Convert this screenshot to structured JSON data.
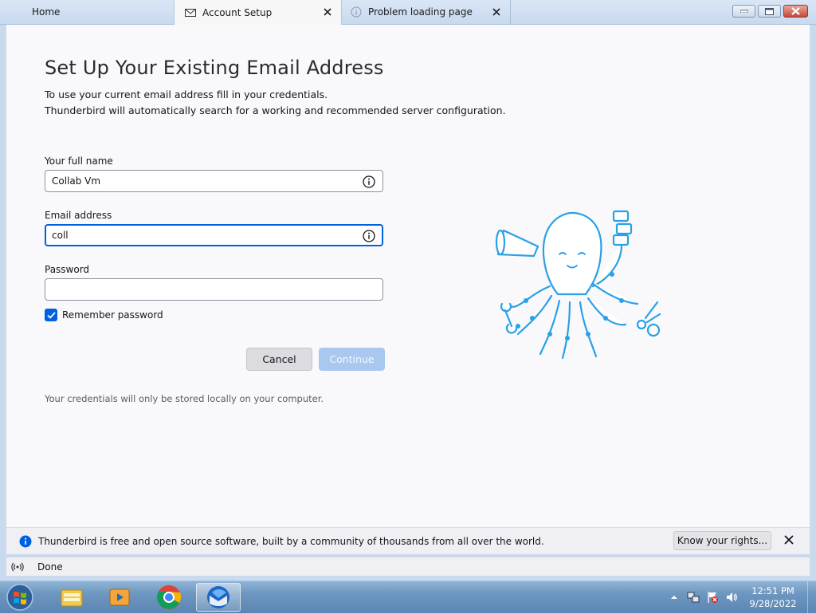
{
  "tabs": [
    {
      "label": "Home"
    },
    {
      "label": "Account Setup"
    },
    {
      "label": "Problem loading page"
    }
  ],
  "page": {
    "title": "Set Up Your Existing Email Address",
    "intro_line1": "To use your current email address fill in your credentials.",
    "intro_line2": "Thunderbird will automatically search for a working and recommended server configuration."
  },
  "form": {
    "name_label": "Your full name",
    "name_value": "Collab Vm",
    "email_label": "Email address",
    "email_value": "coll",
    "password_label": "Password",
    "password_value": "",
    "remember_label": "Remember password",
    "remember_checked": true
  },
  "buttons": {
    "cancel": "Cancel",
    "continue": "Continue"
  },
  "footnote": "Your credentials will only be stored locally on your computer.",
  "notification": {
    "text": "Thunderbird is free and open source software, built by a community of thousands from all over the world.",
    "button": "Know your rights..."
  },
  "status": {
    "text": "Done"
  },
  "taskbar": {
    "time": "12:51 PM",
    "date": "9/28/2022",
    "apps": [
      "windows-explorer-icon",
      "media-player-icon",
      "chrome-icon",
      "thunderbird-icon"
    ]
  },
  "colors": {
    "accent": "#0061e0",
    "continue_disabled": "#a8c8f0",
    "mascot_blue": "#2aa0e6"
  }
}
